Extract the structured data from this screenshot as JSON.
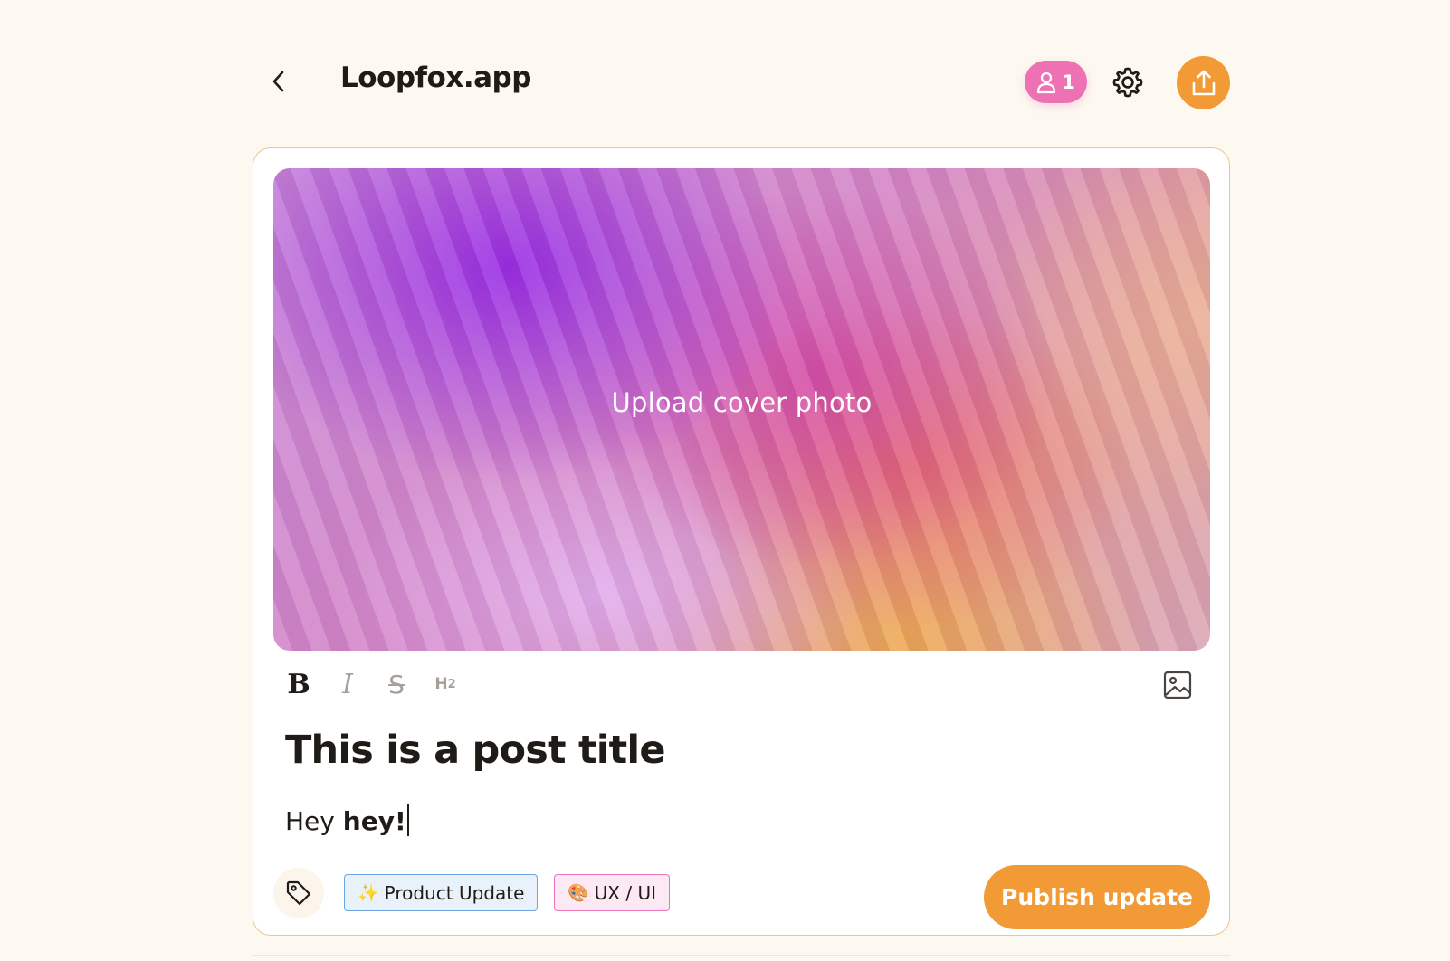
{
  "header": {
    "back_icon": "chevron-left-icon",
    "title": "Loopfox.app",
    "collaborators": {
      "icon": "user-icon",
      "count": "1",
      "color": "#ee72b3"
    },
    "settings_icon": "gear-icon",
    "share": {
      "icon": "share-upload-icon",
      "color": "#f19a36"
    }
  },
  "editor": {
    "cover": {
      "label": "Upload cover photo"
    },
    "toolbar": {
      "bold": "B",
      "italic": "I",
      "strikethrough": "S",
      "heading": "H",
      "heading_level": "2",
      "image_icon": "image-icon"
    },
    "title": "This is a post title",
    "body": {
      "text_plain": "Hey ",
      "text_bold": "hey!"
    },
    "tag_icon": "tag-icon",
    "tags": [
      {
        "emoji": "✨",
        "label": "Product Update",
        "color": "#6ba4e3"
      },
      {
        "emoji": "🎨",
        "label": "UX / UI",
        "color": "#ea73b8"
      }
    ],
    "publish_label": "Publish update",
    "accent": "#f19a36"
  }
}
